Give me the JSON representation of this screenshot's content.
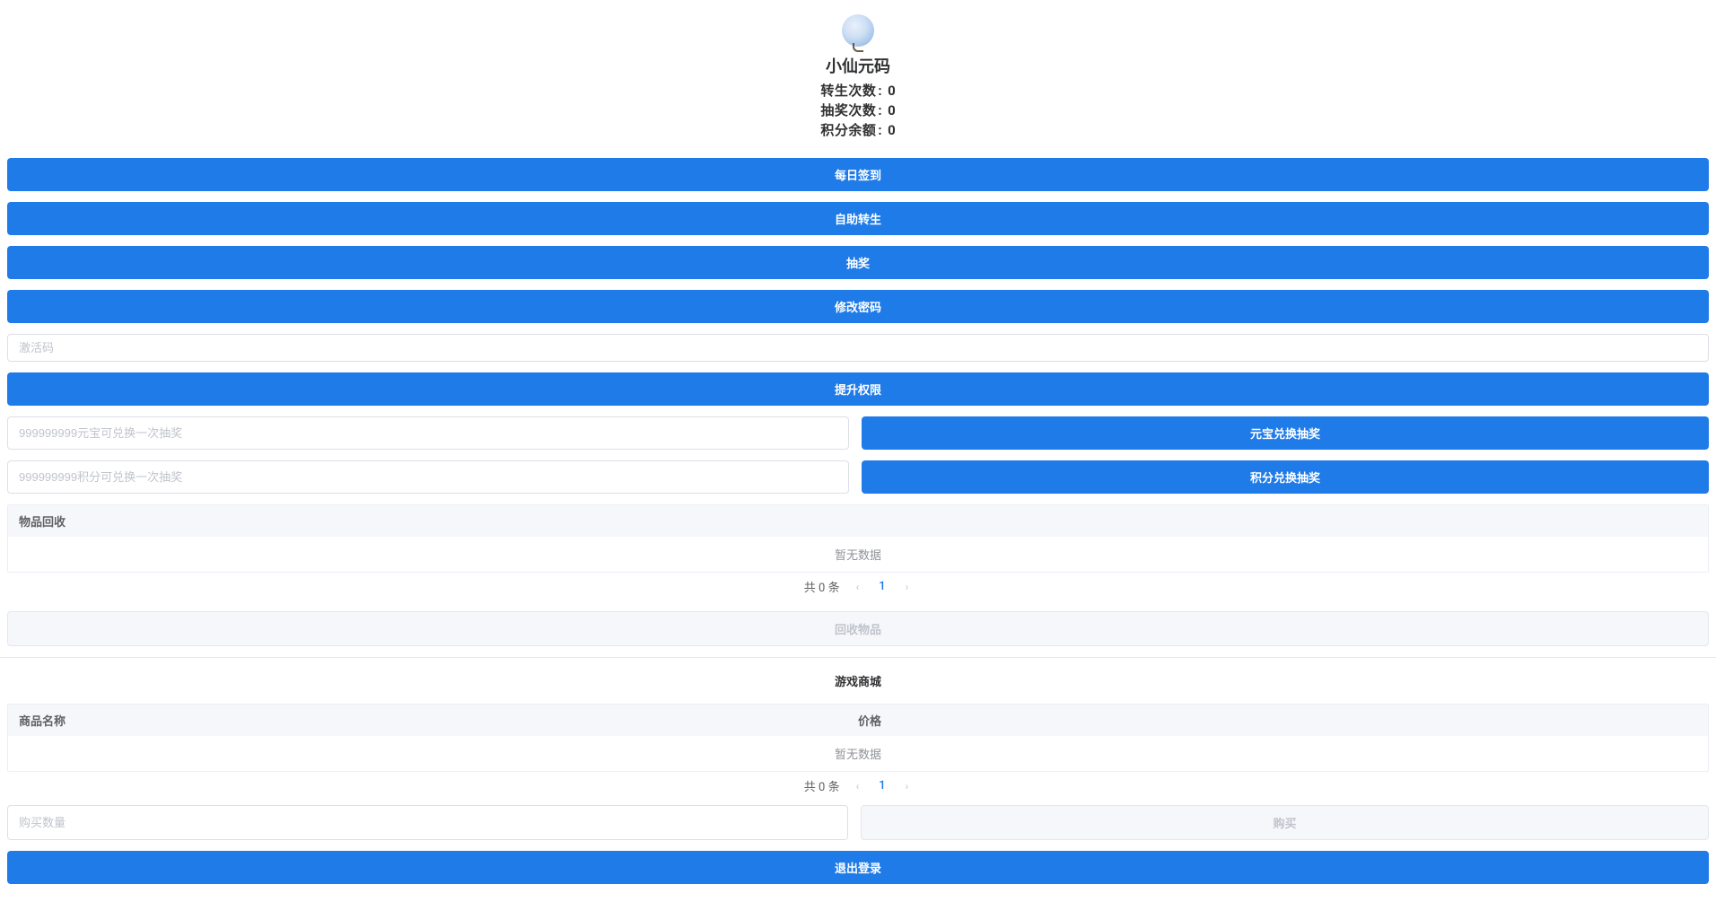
{
  "profile": {
    "username": "小仙元码",
    "stats": [
      {
        "label": "转生次数",
        "value": "0"
      },
      {
        "label": "抽奖次数",
        "value": "0"
      },
      {
        "label": "积分余额",
        "value": "0"
      }
    ]
  },
  "buttons": {
    "dailyCheckin": "每日签到",
    "selfRebirth": "自助转生",
    "lottery": "抽奖",
    "changePassword": "修改密码",
    "upgradePrivilege": "提升权限",
    "exchangeByYuanbao": "元宝兑换抽奖",
    "exchangeByPoints": "积分兑换抽奖",
    "recycleItems": "回收物品",
    "buy": "购买",
    "logout": "退出登录"
  },
  "inputs": {
    "activationCode": {
      "placeholder": "激活码"
    },
    "yuanbaoExchange": {
      "placeholder": "999999999元宝可兑换一次抽奖"
    },
    "pointsExchange": {
      "placeholder": "999999999积分可兑换一次抽奖"
    },
    "buyQuantity": {
      "placeholder": "购买数量"
    }
  },
  "recycle": {
    "header": "物品回收",
    "empty": "暂无数据",
    "totalPrefix": "共",
    "totalSuffix": "条",
    "total": "0",
    "page": "1"
  },
  "shop": {
    "title": "游戏商城",
    "columns": {
      "name": "商品名称",
      "price": "价格"
    },
    "empty": "暂无数据",
    "totalPrefix": "共",
    "totalSuffix": "条",
    "total": "0",
    "page": "1"
  }
}
